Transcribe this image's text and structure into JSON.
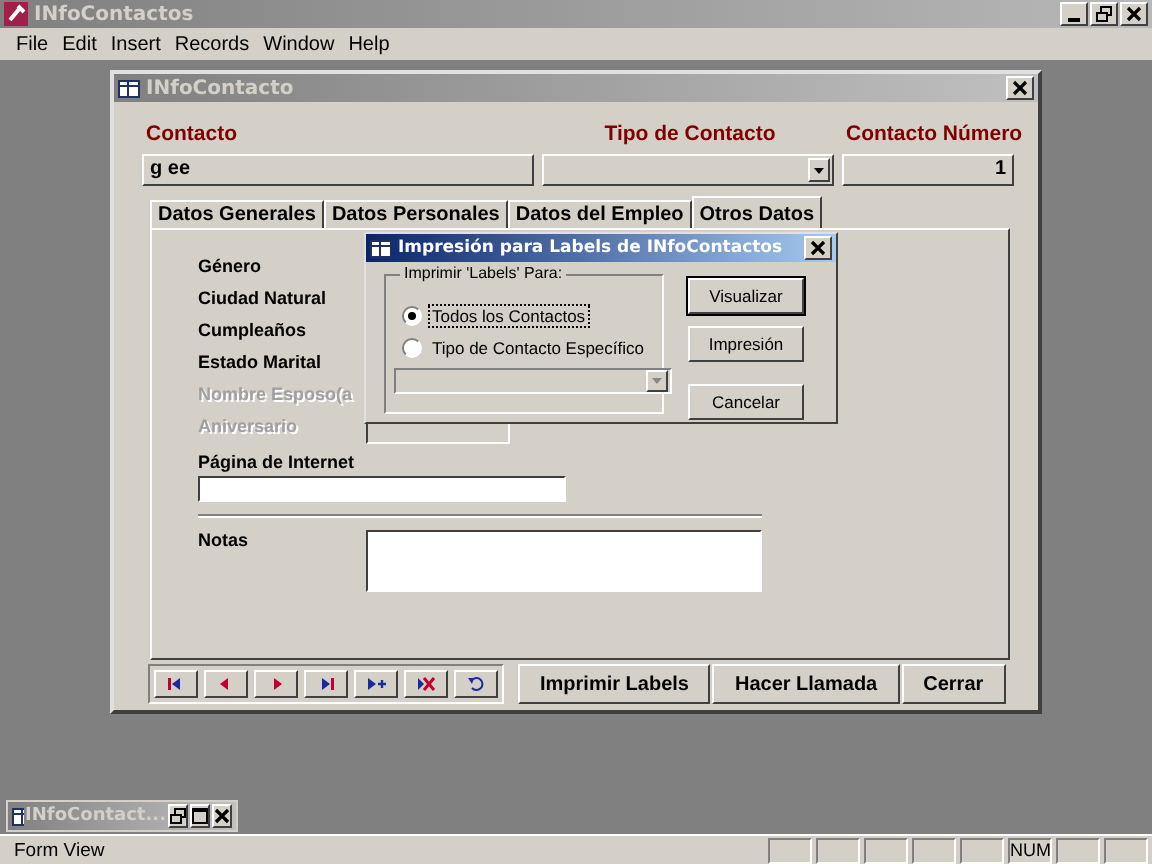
{
  "app": {
    "title": "INfoContactos"
  },
  "menu": [
    "File",
    "Edit",
    "Insert",
    "Records",
    "Window",
    "Help"
  ],
  "form": {
    "title": "INfoContacto",
    "header_fields": [
      {
        "label": "Contacto",
        "value": "g ee",
        "kind": "text"
      },
      {
        "label": "Tipo de Contacto",
        "kind": "combo"
      },
      {
        "label": "Contacto Número",
        "value": "1",
        "kind": "number"
      }
    ],
    "tabs": [
      {
        "label": "Datos Generales",
        "selected": false
      },
      {
        "label": "Datos Personales",
        "selected": false
      },
      {
        "label": "Datos del Empleo",
        "selected": false
      },
      {
        "label": "Otros Datos",
        "selected": true
      }
    ],
    "fields": [
      {
        "label": "Género",
        "disabled": false
      },
      {
        "label": "Ciudad Natural",
        "disabled": false
      },
      {
        "label": "Cumpleaños",
        "disabled": false
      },
      {
        "label": "Estado Marital",
        "disabled": false
      },
      {
        "label": "Nombre Esposo(a",
        "disabled": true
      },
      {
        "label": "Aniversario",
        "disabled": true
      }
    ],
    "web_label": "Página de Internet",
    "notes_label": "Notas",
    "buttons": [
      "Imprimir Labels",
      "Hacer Llamada",
      "Cerrar"
    ]
  },
  "dialog": {
    "title": "Impresión para  Labels de INfoContactos",
    "group_label": "Imprimir 'Labels' Para:",
    "options": [
      {
        "label": "Todos los Contactos",
        "selected": true
      },
      {
        "label": "Tipo de Contacto Específico",
        "selected": false
      }
    ],
    "buttons": [
      "Visualizar",
      "Impresión",
      "Cancelar"
    ]
  },
  "minimized": {
    "title": "INfoContact..."
  },
  "status_bar": {
    "text": "Form View",
    "indicators": [
      "NUM"
    ]
  }
}
